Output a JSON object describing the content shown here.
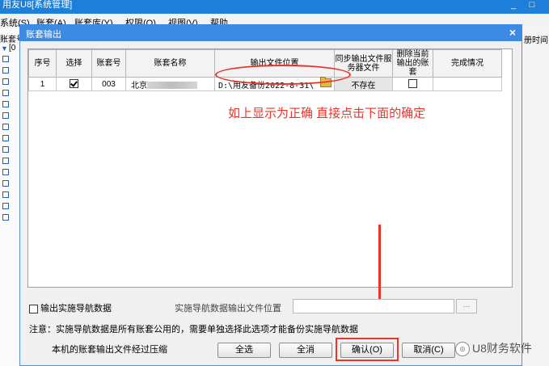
{
  "main_window": {
    "title": "用友U8[系统管理]",
    "minimize": "_",
    "close": "□",
    "menu": [
      "系统(S)",
      "账套(A)",
      "账套库(Y)",
      "权限(O)",
      "视图(V)",
      "帮助"
    ],
    "left_label": "账套号",
    "tree_root": "[0",
    "right_label": "册时间"
  },
  "dialog": {
    "title": "账套输出",
    "close": "×",
    "columns": [
      "序号",
      "选择",
      "账套号",
      "账套名称",
      "输出文件位置",
      "同步输出文件服务器文件",
      "删除当前输出的账套",
      "完成情况"
    ],
    "rows": [
      {
        "index": "1",
        "selected": true,
        "code": "003",
        "name": "北京",
        "path": "D:\\用友备份2022-8-31\\",
        "sync": "不存在",
        "delete": false,
        "status": ""
      }
    ],
    "nav_checkbox_label": "输出实施导航数据",
    "nav_path_label": "实施导航数据输出文件位置",
    "nav_path_value": "",
    "browse": "...",
    "note": "注意：实施导航数据是所有账套公用的，需要单独选择此选项才能备份实施导航数据",
    "compress_note": "本机的账套输出文件经过压缩",
    "buttons": {
      "select_all": "全选",
      "deselect_all": "全消",
      "confirm": "确认(O)",
      "cancel": "取消(C)"
    }
  },
  "annotation": {
    "text": "如上显示为正确  直接点击下面的确定",
    "color": "#e8352a"
  },
  "watermark": "U8财务软件"
}
